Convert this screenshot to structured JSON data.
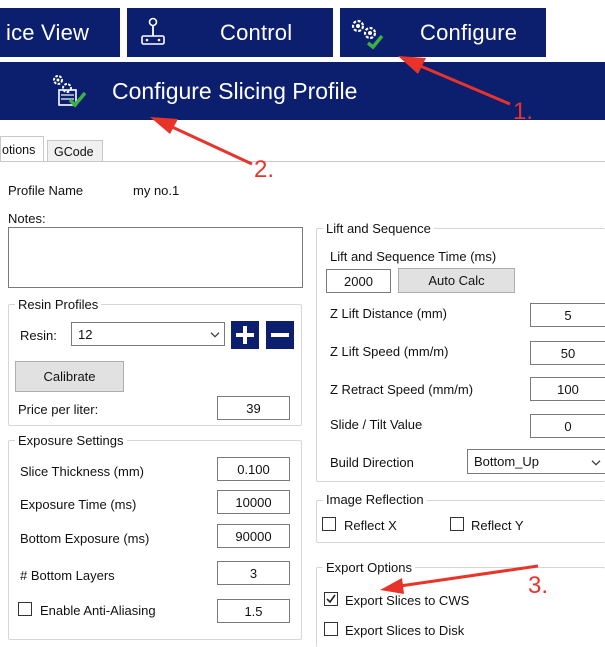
{
  "nav": {
    "tabs": [
      {
        "label": "ice View"
      },
      {
        "label": "Control"
      },
      {
        "label": "Configure"
      }
    ]
  },
  "banner": {
    "title": "Configure Slicing Profile"
  },
  "tabs": [
    {
      "label": "otions"
    },
    {
      "label": "GCode"
    }
  ],
  "profile": {
    "name_label": "Profile Name",
    "name_value": "my no.1",
    "notes_label": "Notes:"
  },
  "resin": {
    "group_title": "Resin Profiles",
    "resin_label": "Resin:",
    "resin_value": "12",
    "calibrate_label": "Calibrate",
    "price_label": "Price per liter:",
    "price_value": "39"
  },
  "exposure": {
    "group_title": "Exposure Settings",
    "rows": [
      {
        "label": "Slice Thickness (mm)",
        "value": "0.100"
      },
      {
        "label": "Exposure Time (ms)",
        "value": "10000"
      },
      {
        "label": "Bottom Exposure (ms)",
        "value": "90000"
      },
      {
        "label": "# Bottom Layers",
        "value": "3"
      }
    ],
    "antialias_label": "Enable Anti-Aliasing",
    "antialias_value": "1.5"
  },
  "lift": {
    "group_title": "Lift and Sequence",
    "time_label": "Lift and Sequence Time (ms)",
    "time_value": "2000",
    "autocalc_label": "Auto Calc",
    "rows": [
      {
        "label": "Z Lift Distance (mm)",
        "value": "5"
      },
      {
        "label": "Z Lift Speed (mm/m)",
        "value": "50"
      },
      {
        "label": "Z Retract Speed (mm/m)",
        "value": "100"
      },
      {
        "label": "Slide / Tilt Value",
        "value": "0"
      }
    ],
    "build_dir_label": "Build Direction",
    "build_dir_value": "Bottom_Up"
  },
  "reflection": {
    "group_title": "Image Reflection",
    "reflect_x": "Reflect X",
    "reflect_y": "Reflect Y"
  },
  "export": {
    "group_title": "Export Options",
    "cws_label": "Export Slices to CWS",
    "cws_checked": true,
    "disk_label": "Export Slices to Disk",
    "disk_checked": false
  },
  "annotations": [
    "1.",
    "2.",
    "3."
  ],
  "colors": {
    "brand": "#0b1f6e",
    "annotation": "#e8332a",
    "check_green": "#3cb043"
  }
}
